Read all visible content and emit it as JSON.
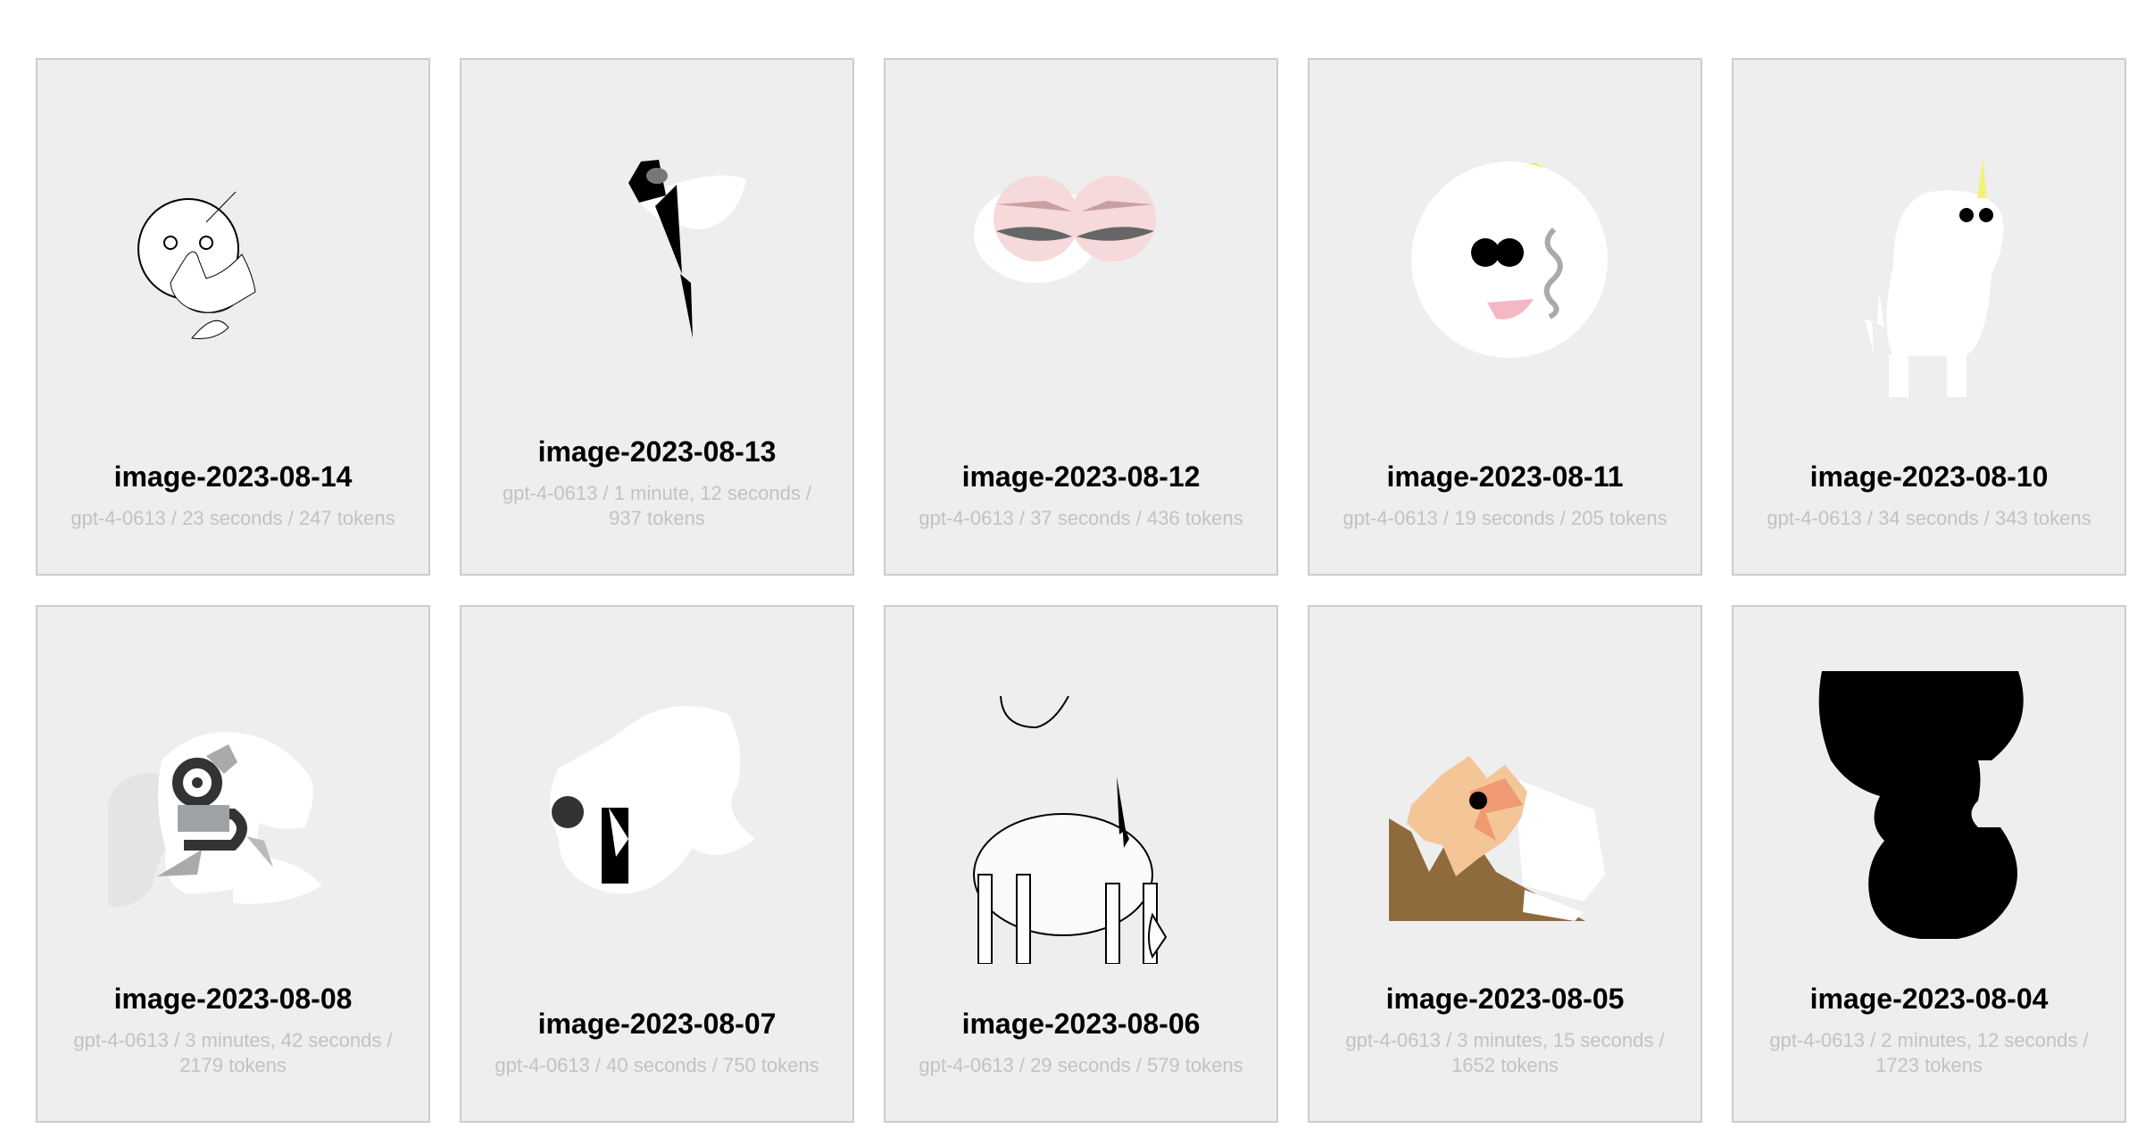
{
  "cards": [
    {
      "title": "image-2023-08-14",
      "meta": "gpt-4-0613 / 23 seconds / 247 tokens"
    },
    {
      "title": "image-2023-08-13",
      "meta": "gpt-4-0613 / 1 minute, 12 seconds / 937 tokens"
    },
    {
      "title": "image-2023-08-12",
      "meta": "gpt-4-0613 / 37 seconds / 436 tokens"
    },
    {
      "title": "image-2023-08-11",
      "meta": "gpt-4-0613 / 19 seconds / 205 tokens"
    },
    {
      "title": "image-2023-08-10",
      "meta": "gpt-4-0613 / 34 seconds / 343 tokens"
    },
    {
      "title": "image-2023-08-08",
      "meta": "gpt-4-0613 / 3 minutes, 42 seconds / 2179 tokens"
    },
    {
      "title": "image-2023-08-07",
      "meta": "gpt-4-0613 / 40 seconds / 750 tokens"
    },
    {
      "title": "image-2023-08-06",
      "meta": "gpt-4-0613 / 29 seconds / 579 tokens"
    },
    {
      "title": "image-2023-08-05",
      "meta": "gpt-4-0613 / 3 minutes, 15 seconds / 1652 tokens"
    },
    {
      "title": "image-2023-08-04",
      "meta": "gpt-4-0613 / 2 minutes, 12 seconds / 1723 tokens"
    }
  ]
}
